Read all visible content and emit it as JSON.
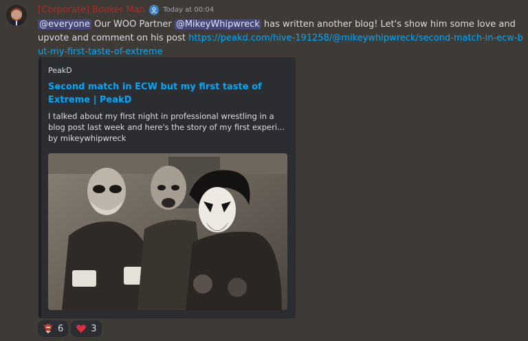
{
  "message": {
    "author": "[Corporate] Booker Man",
    "timestamp": "Today at 00:04",
    "mention_everyone": "@everyone",
    "text_part1": " Our WOO Partner ",
    "mention_user": "@MikeyWhipwreck",
    "text_part2": " has written another blog! Let's show him some love and upvote and comment on his post ",
    "link": "https://peakd.com/hive-191258/@mikeywhipwreck/second-match-in-ecw-but-my-first-taste-of-extreme"
  },
  "embed": {
    "provider": "PeakD",
    "title": "Second match in ECW but my first taste of Extreme | PeakD",
    "description": "I talked about my first night in professional wrestling in a blog post last week and here's the story of my first experi... by mikeywhipwreck"
  },
  "reactions": [
    {
      "icon": "wrestler-emoji-icon",
      "count": "6"
    },
    {
      "icon": "heart-emoji-icon",
      "count": "3"
    }
  ],
  "colors": {
    "background": "#3e3a35",
    "username": "#b02a26",
    "link": "#00a8fc",
    "embed_bg": "#2b2d31",
    "mention_bg": "#4b4f8a"
  }
}
